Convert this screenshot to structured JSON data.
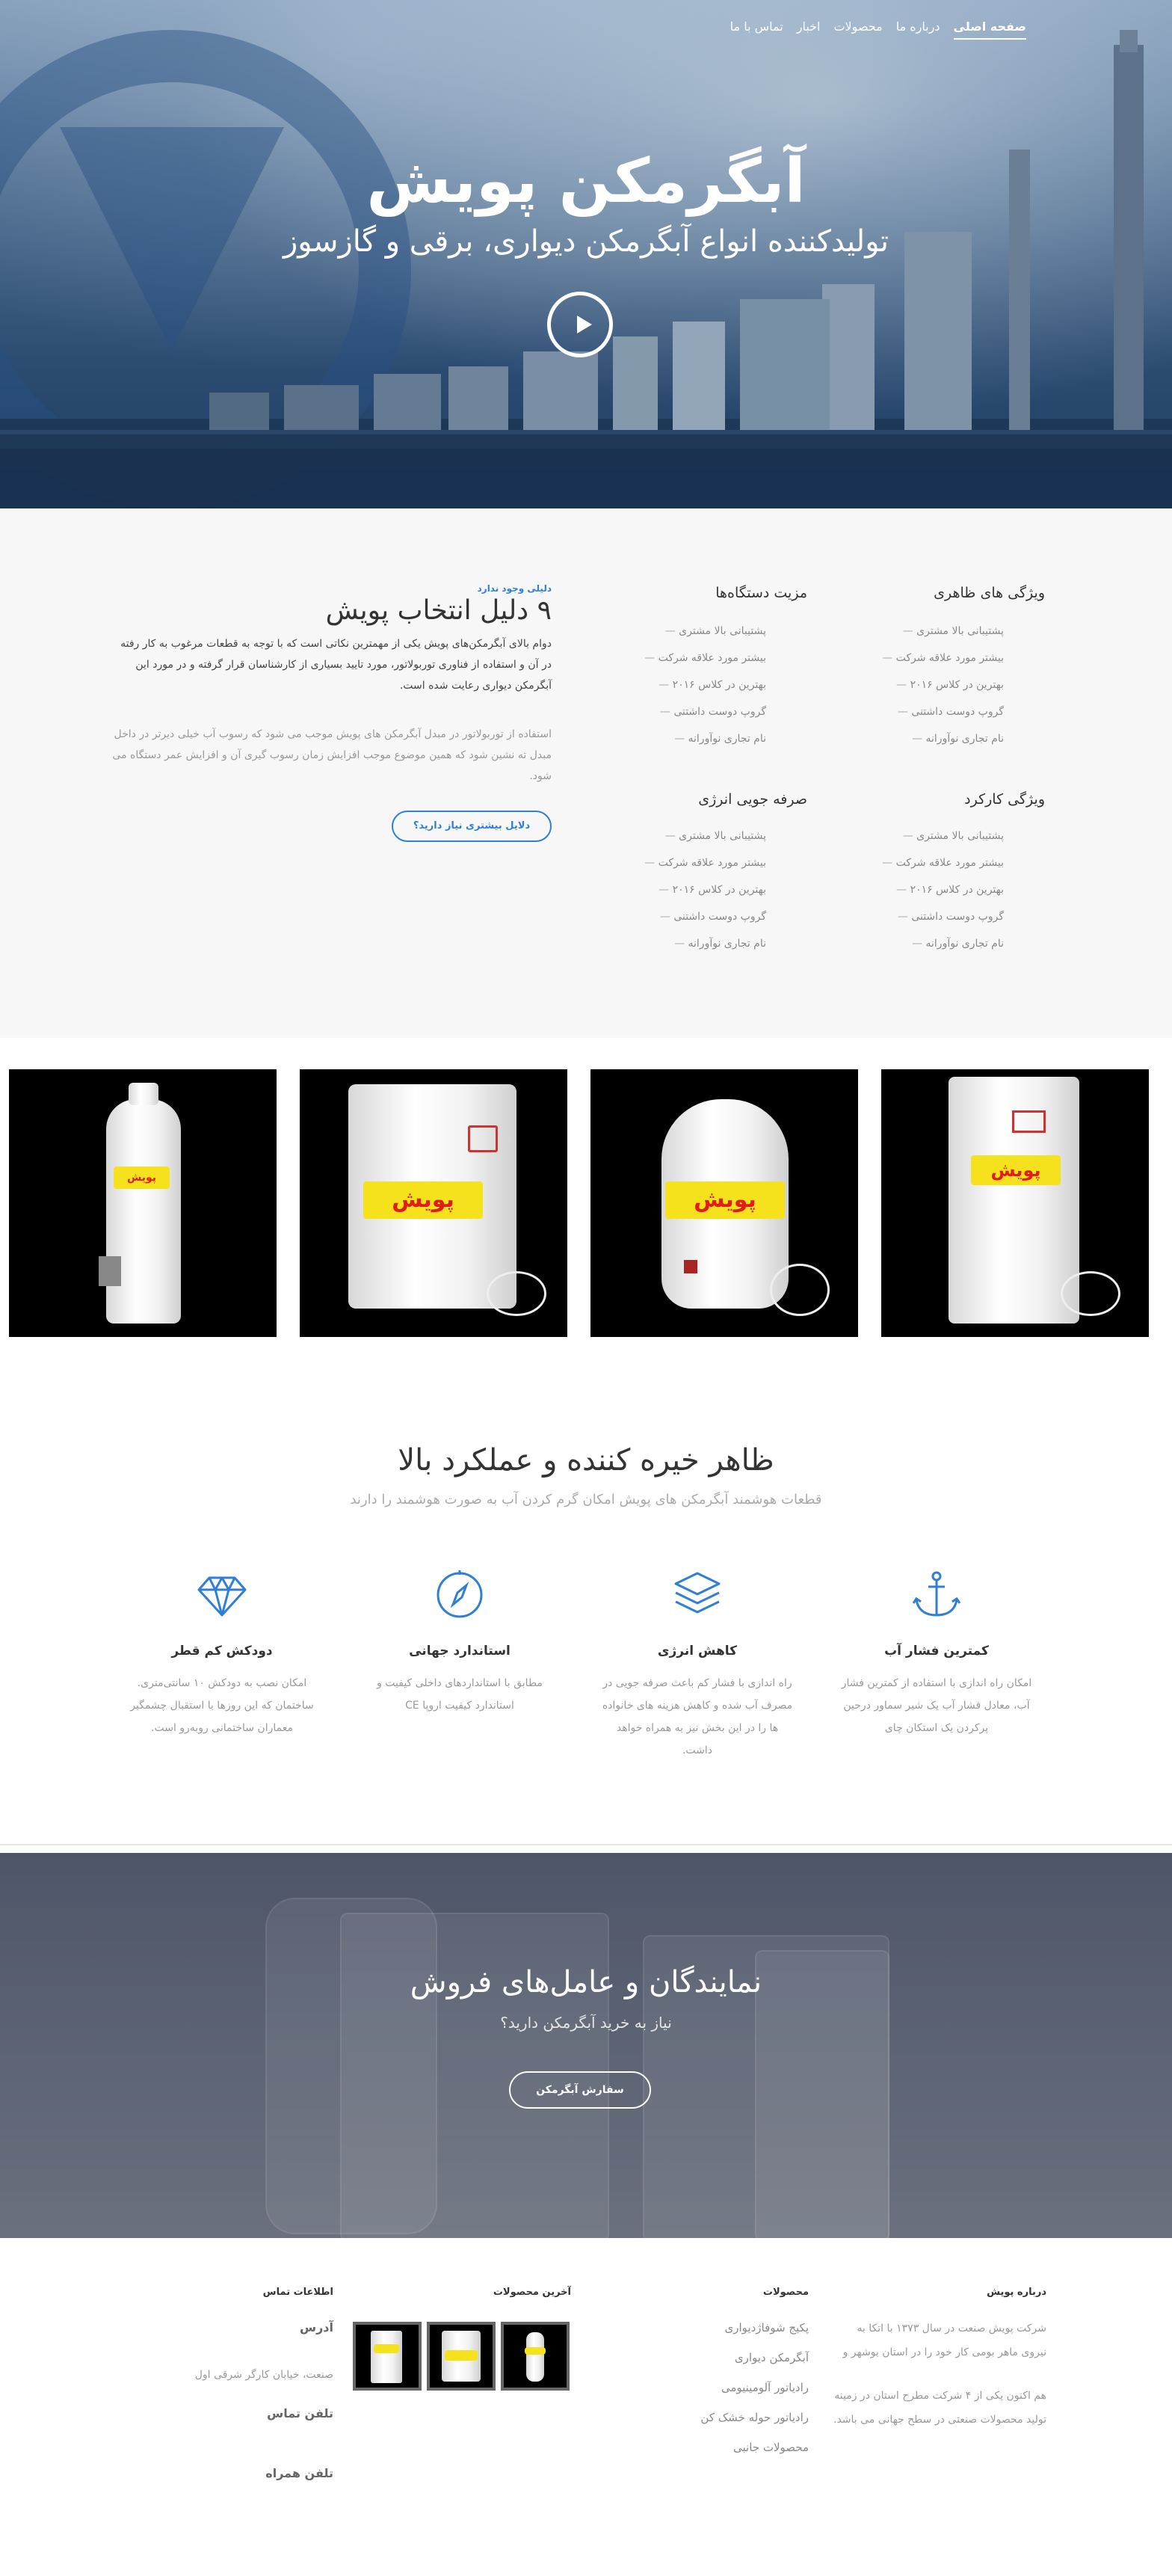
{
  "nav": {
    "items": [
      {
        "label": "صفحه اصلی",
        "active": true
      },
      {
        "label": "درباره ما",
        "active": false
      },
      {
        "label": "محصولات",
        "active": false
      },
      {
        "label": "اخبار",
        "active": false
      },
      {
        "label": "تماس با ما",
        "active": false
      }
    ]
  },
  "hero": {
    "title": "آبگرمکن پویش",
    "subtitle": "تولیدکننده انواع آبگرمکن دیواری، برقی و گازسوز"
  },
  "features": {
    "col1": {
      "title": "ویژگی های ظاهری",
      "items": [
        "پشتیبانی بالا مشتری",
        "بیشتر مورد علاقه شرکت",
        "بهترین در کلاس ۲۰۱۶",
        "گروپ دوست داشتنی",
        "نام تجاری نوآورانه"
      ]
    },
    "col2": {
      "title": "مزیت دستگاه‌ها",
      "items": [
        "پشتیبانی بالا مشتری",
        "بیشتر مورد علاقه شرکت",
        "بهترین در کلاس ۲۰۱۶",
        "گروپ دوست داشتنی",
        "نام تجاری نوآورانه"
      ]
    },
    "col3": {
      "title": "ویژگی کارکرد",
      "items": [
        "پشتیبانی بالا مشتری",
        "بیشتر مورد علاقه شرکت",
        "بهترین در کلاس ۲۰۱۶",
        "گروپ دوست داشتنی",
        "نام تجاری نوآورانه"
      ]
    },
    "col4": {
      "title": "صرفه جویی انرژی",
      "items": [
        "پشتیبانی بالا مشتری",
        "بیشتر مورد علاقه شرکت",
        "بهترین در کلاس ۲۰۱۶",
        "گروپ دوست داشتنی",
        "نام تجاری نوآورانه"
      ]
    },
    "eyebrow": "دلیلی وجود ندارد",
    "heading": "۹ دلیل انتخاب پویش",
    "para1": "دوام بالای آبگرمکن‌های پویش یکی از مهمترین نکاتی است که با توجه به قطعات مرغوب به کار رفته در آن و استفاده از فناوری توربولاتور، مورد تایید بسیاری از کارشناسان قرار گرفته و در مورد این آبگرمکن دیواری رعایت شده است.",
    "para2": "استفاده از توربولاتور در مبدل آبگرمکن های پویش موجب می شود که رسوب آب خیلی دیرتر در داخل مبدل ته نشین شود که همین موضوع موجب افزایش زمان رسوب گیری آن و افزایش عمر دستگاه می شود.",
    "button": "دلایل بیشتری نیاز دارید؟"
  },
  "products": {
    "label": "پویش"
  },
  "advantages": {
    "title": "ظاهر خیره کننده و عملکرد بالا",
    "subtitle": "قطعات هوشمند آبگرمکن های پویش امکان گرم کردن آب به صورت هوشمند را دارند",
    "items": [
      {
        "icon": "anchor-icon",
        "title": "کمترین فشار آب",
        "text": "امکان راه اندازی با استفاده از کمترین فشار آب، معادل فشار آب یک شیر سماور درحین پرکردن یک استکان چای"
      },
      {
        "icon": "layers-icon",
        "title": "کاهش انرژی",
        "text": "راه اندازی با فشار کم باعث صرفه جویی در مصرف آب شده و کاهش هزینه های خانواده ها را در این بخش نیز به همراه خواهد داشت."
      },
      {
        "icon": "compass-icon",
        "title": "استاندارد جهانی",
        "text": "مطابق با استانداردهای داخلی کیفیت و استاندارد کیفیت اروپا CE"
      },
      {
        "icon": "diamond-icon",
        "title": "دودکش کم قطر",
        "text": "امکان نصب به دودکش ۱۰ سانتی‌متری. ساختمان که این روزها با استقبال چشمگیر معماران ساختمانی روبه‌رو است."
      }
    ]
  },
  "dealers": {
    "title": "نمایندگان و عامل‌های فروش",
    "subtitle": "نیاز به خرید آبگرمکن دارید؟",
    "button": "سفارش آبگرمکن"
  },
  "footer": {
    "about": {
      "heading": "درباره پویش",
      "para1": "شرکت پویش صنعت در سال ۱۳۷۳ با اتکا به نیروی ماهر بومی کار خود را در استان بوشهر و",
      "para2": "هم اکنون یکی از ۴ شرکت مطرح استان در زمینه تولید محصولات صنعتی در سطح جهانی می باشد."
    },
    "products": {
      "heading": "محصولات",
      "items": [
        "پکیج شوفاژدیواری",
        "آبگرمکن دیواری",
        "رادیاتور آلومینیومی",
        "رادیاتور حوله خشک کن",
        "محصولات جانبی"
      ]
    },
    "latest": {
      "heading": "آخرین محصولات"
    },
    "contact": {
      "heading": "اطلاعات تماس",
      "address_label": "آدرس",
      "address_value": "صنعت، خیابان کارگر شرقی اول",
      "phone_label": "تلفن تماس",
      "mobile_label": "تلفن همراه"
    }
  }
}
